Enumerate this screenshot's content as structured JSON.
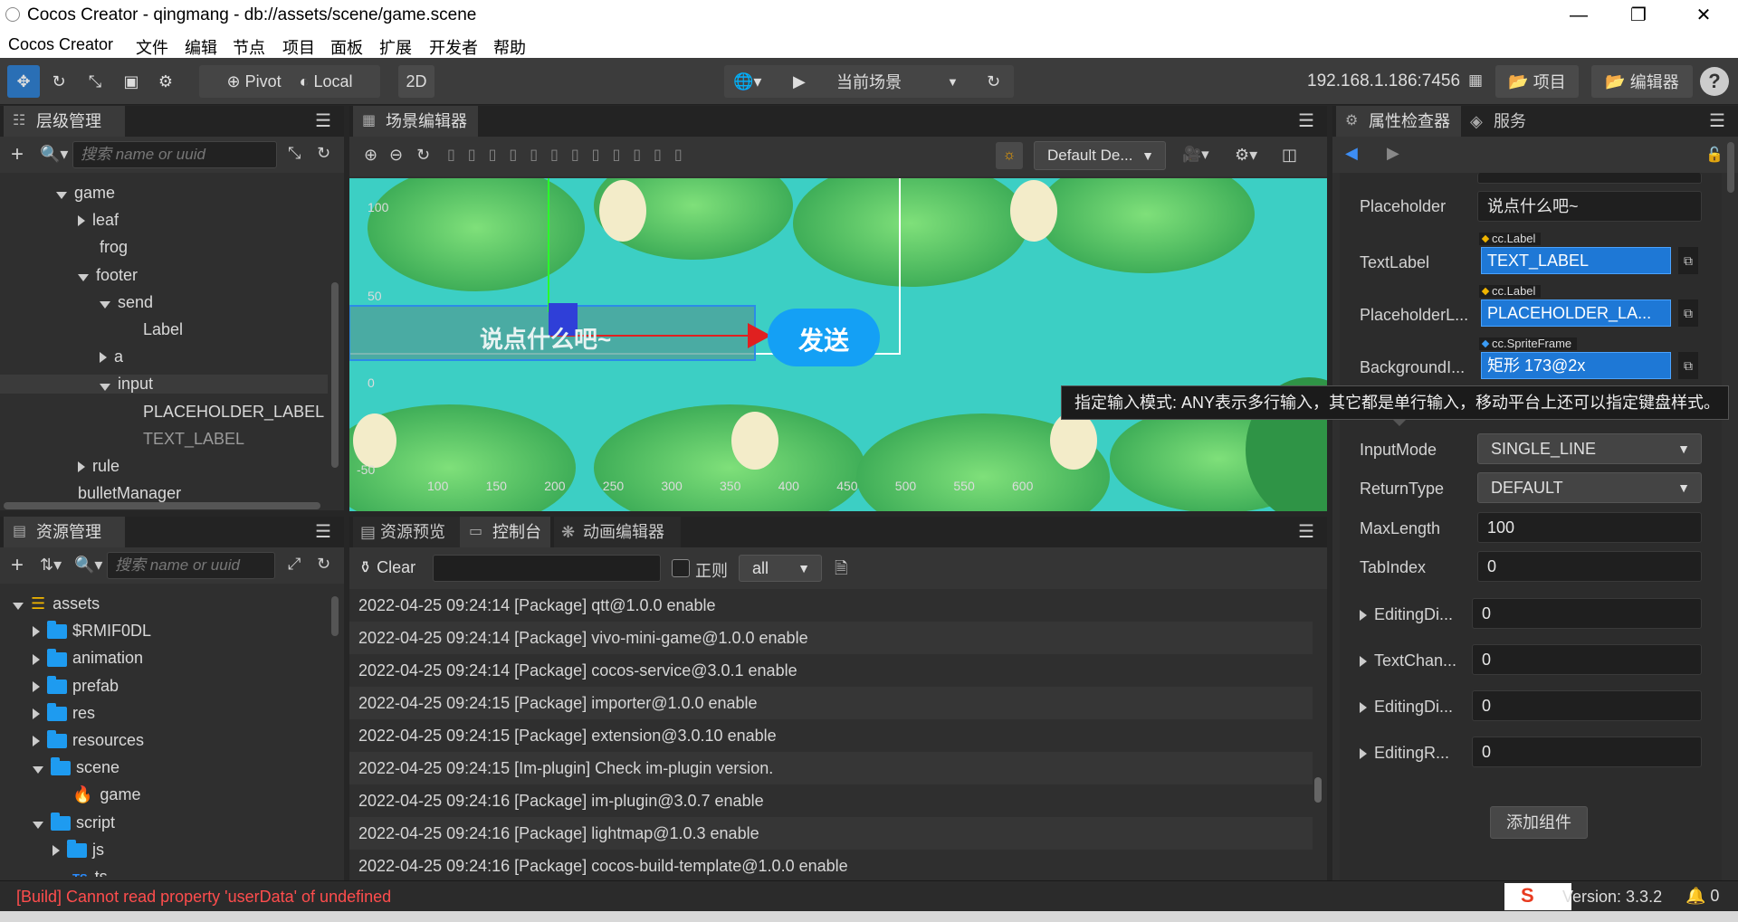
{
  "window": {
    "title": "Cocos Creator - qingmang - db://assets/scene/game.scene"
  },
  "menu": [
    "Cocos Creator",
    "文件",
    "编辑",
    "节点",
    "项目",
    "面板",
    "扩展",
    "开发者",
    "帮助"
  ],
  "toolbar": {
    "pivot": "Pivot",
    "local": "Local",
    "mode2d": "2D",
    "scene_select": "当前场景",
    "ip": "192.168.1.186:7456",
    "project_btn": "项目",
    "editor_btn": "编辑器",
    "help": "?"
  },
  "hierarchy": {
    "tab": "层级管理器",
    "search_placeholder": "搜索 name or uuid",
    "nodes": [
      {
        "label": "game",
        "depth": 0,
        "expand": "d"
      },
      {
        "label": "leaf",
        "depth": 1,
        "expand": "r"
      },
      {
        "label": "frog",
        "depth": 1,
        "expand": ""
      },
      {
        "label": "footer",
        "depth": 1,
        "expand": "d"
      },
      {
        "label": "send",
        "depth": 2,
        "expand": "d"
      },
      {
        "label": "Label",
        "depth": 3,
        "expand": ""
      },
      {
        "label": "a",
        "depth": 2,
        "expand": "r"
      },
      {
        "label": "input",
        "depth": 2,
        "expand": "d"
      },
      {
        "label": "PLACEHOLDER_LABEL",
        "depth": 3,
        "expand": ""
      },
      {
        "label": "TEXT_LABEL",
        "depth": 3,
        "expand": ""
      },
      {
        "label": "rule",
        "depth": 1,
        "expand": "r"
      },
      {
        "label": "bulletManager",
        "depth": 0,
        "expand": ""
      }
    ]
  },
  "assets": {
    "tab": "资源管理器",
    "search_placeholder": "搜索 name or uuid",
    "items": [
      {
        "label": "assets",
        "depth": 0,
        "expand": "d",
        "kind": "db"
      },
      {
        "label": "$RMIF0DL",
        "depth": 1,
        "expand": "r",
        "kind": "folder"
      },
      {
        "label": "animation",
        "depth": 1,
        "expand": "r",
        "kind": "folder"
      },
      {
        "label": "prefab",
        "depth": 1,
        "expand": "r",
        "kind": "folder"
      },
      {
        "label": "res",
        "depth": 1,
        "expand": "r",
        "kind": "folder"
      },
      {
        "label": "resources",
        "depth": 1,
        "expand": "r",
        "kind": "folder"
      },
      {
        "label": "scene",
        "depth": 1,
        "expand": "d",
        "kind": "folder"
      },
      {
        "label": "game",
        "depth": 2,
        "expand": "",
        "kind": "scene"
      },
      {
        "label": "script",
        "depth": 1,
        "expand": "d",
        "kind": "folder"
      },
      {
        "label": "js",
        "depth": 2,
        "expand": "r",
        "kind": "folder"
      },
      {
        "label": "ts",
        "depth": 2,
        "expand": "",
        "kind": "ts"
      }
    ]
  },
  "scene": {
    "tab": "场景编辑器",
    "camera_select": "Default De...",
    "axis_y": [
      "100",
      "50",
      "0",
      "-50"
    ],
    "axis_x": [
      "100",
      "150",
      "200",
      "250",
      "300",
      "350",
      "400",
      "450",
      "500",
      "550",
      "600"
    ],
    "input_text": "说点什么吧~",
    "send_label": "发送"
  },
  "console": {
    "tabs": [
      "资源预览",
      "控制台",
      "动画编辑器"
    ],
    "clear_label": "Clear",
    "regex_label": "正则",
    "filter_value": "all",
    "logs": [
      "2022-04-25 09:24:14 [Package] qtt@1.0.0 enable",
      "2022-04-25 09:24:14 [Package] vivo-mini-game@1.0.0 enable",
      "2022-04-25 09:24:14 [Package] cocos-service@3.0.1 enable",
      "2022-04-25 09:24:15 [Package] importer@1.0.0 enable",
      "2022-04-25 09:24:15 [Package] extension@3.0.10 enable",
      "2022-04-25 09:24:15 [Im-plugin] Check im-plugin version.",
      "2022-04-25 09:24:16 [Package] im-plugin@3.0.7 enable",
      "2022-04-25 09:24:16 [Package] lightmap@1.0.3 enable",
      "2022-04-25 09:24:16 [Package] cocos-build-template@1.0.0 enable"
    ]
  },
  "inspector": {
    "tabs": [
      "属性检查器",
      "服务"
    ],
    "placeholder_label": "Placeholder",
    "placeholder_value": "说点什么吧~",
    "textlabel_label": "TextLabel",
    "textlabel_type": "cc.Label",
    "textlabel_value": "TEXT_LABEL",
    "placeholderl_label": "PlaceholderL...",
    "placeholderl_type": "cc.Label",
    "placeholderl_value": "PLACEHOLDER_LA...",
    "background_label": "BackgroundI...",
    "background_type": "cc.SpriteFrame",
    "background_value": "矩形 173@2x",
    "tooltip": "指定输入模式: ANY表示多行输入，其它都是单行输入，移动平台上还可以指定键盘样式。",
    "inputmode_label": "InputMode",
    "inputmode_value": "SINGLE_LINE",
    "returntype_label": "ReturnType",
    "returntype_value": "DEFAULT",
    "maxlength_label": "MaxLength",
    "maxlength_value": "100",
    "tabindex_label": "TabIndex",
    "tabindex_value": "0",
    "events": [
      {
        "label": "EditingDi...",
        "value": "0"
      },
      {
        "label": "TextChan...",
        "value": "0"
      },
      {
        "label": "EditingDi...",
        "value": "0"
      },
      {
        "label": "EditingR...",
        "value": "0"
      }
    ],
    "add_component": "添加组件"
  },
  "status": {
    "error": "[Build] Cannot read property 'userData' of undefined",
    "version": "Version: 3.3.2",
    "notifications": "0"
  }
}
